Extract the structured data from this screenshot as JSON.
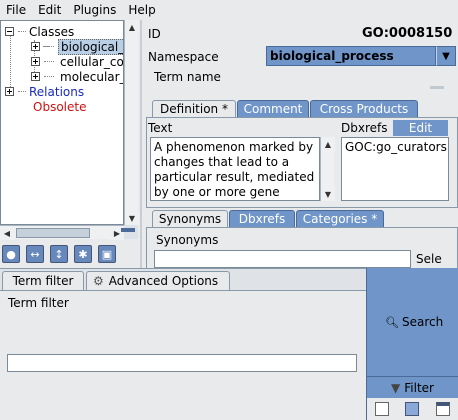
{
  "menubar": {
    "items": [
      "File",
      "Edit",
      "Plugins",
      "Help"
    ]
  },
  "tree": {
    "root": "Classes",
    "children": [
      "biological_",
      "cellular_co",
      "molecular_"
    ],
    "relations": "Relations",
    "obsolete": "Obsolete"
  },
  "term": {
    "id_label": "ID",
    "id_value": "GO:0008150",
    "namespace_label": "Namespace",
    "namespace_value": "biological_process",
    "term_name_label": "Term name"
  },
  "tabs_top": [
    "Definition *",
    "Comment",
    "Cross Products"
  ],
  "definition": {
    "text_label": "Text",
    "text_value": "A phenomenon marked by changes that lead to a particular result, mediated by one or more gene",
    "dbxrefs_label": "Dbxrefs",
    "edit_label": "Edit",
    "dbxref_value": "GOC:go_curators"
  },
  "tabs_mid": [
    "Synonyms",
    "Dbxrefs",
    "Categories *"
  ],
  "synonyms": {
    "label": "Synonyms",
    "sele_label": "Sele"
  },
  "bottom": {
    "tabs": [
      "Term filter",
      "Advanced Options"
    ],
    "filter_label": "Term filter",
    "search_label": "Search",
    "filter_btn_label": "Filter"
  },
  "colors": {
    "accent": "#6f95c9",
    "relations": "#1a2bbf",
    "obsolete": "#d01010"
  }
}
